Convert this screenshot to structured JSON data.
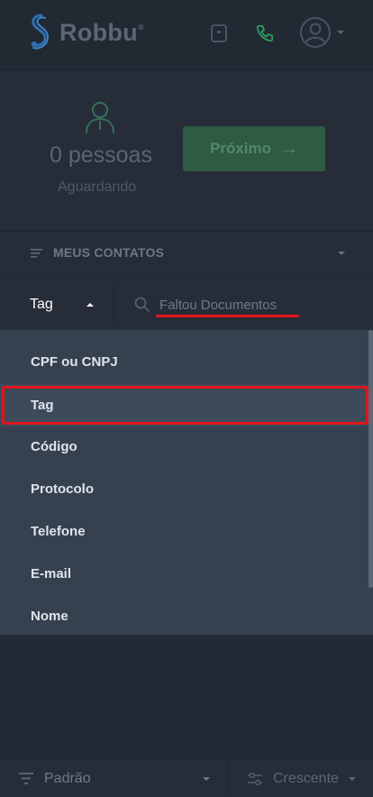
{
  "header": {
    "brand": "Robbu",
    "brand_mark": "®",
    "icons": [
      "robbu-logo-icon",
      "tablet-icon",
      "phone-icon",
      "user-avatar-icon",
      "chevron-down-icon"
    ]
  },
  "summary": {
    "count_label": "0 pessoas",
    "status_label": "Aguardando",
    "next_button": "Próximo",
    "next_button_arrow": "→"
  },
  "contacts": {
    "title": "MEUS CONTATOS"
  },
  "filter": {
    "selected": "Tag",
    "search_value": "Faltou Documentos"
  },
  "dropdown": {
    "items": [
      {
        "label": "CPF ou CNPJ"
      },
      {
        "label": "Tag"
      },
      {
        "label": "Código"
      },
      {
        "label": "Protocolo"
      },
      {
        "label": "Telefone"
      },
      {
        "label": "E-mail"
      },
      {
        "label": "Nome"
      }
    ],
    "selected_index": 1
  },
  "footer": {
    "sort_label": "Padrão",
    "order_label": "Crescente"
  },
  "colors": {
    "background": "#232a35",
    "accent_green": "#2f5a43",
    "dropdown_bg": "#364150",
    "annotation_red": "#e0161b"
  }
}
